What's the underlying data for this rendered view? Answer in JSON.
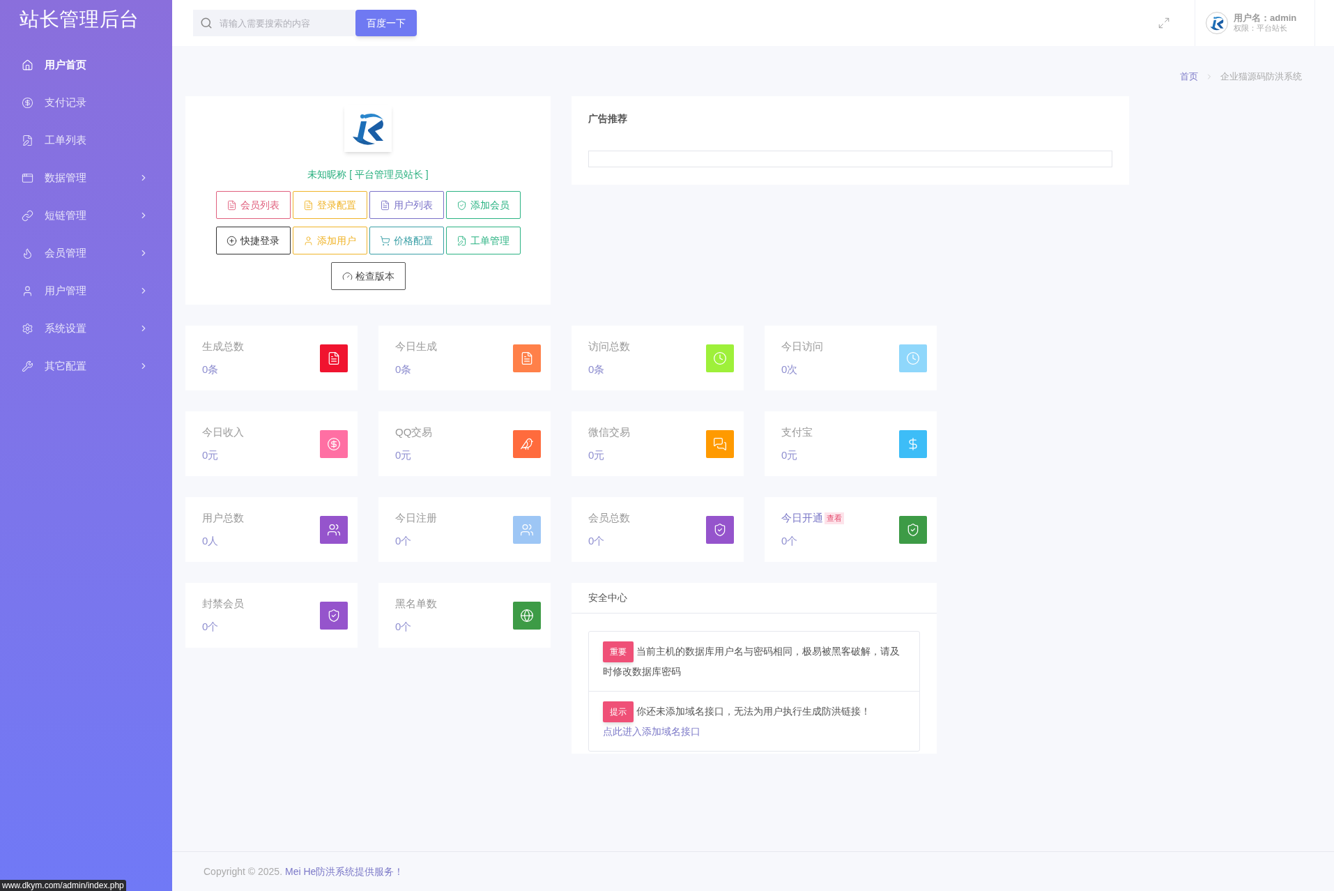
{
  "sidebar": {
    "title": "站长管理后台",
    "items": [
      {
        "label": "用户首页",
        "kind": "home",
        "selected": true,
        "expandable": false
      },
      {
        "label": "支付记录",
        "kind": "yen",
        "selected": false,
        "expandable": false
      },
      {
        "label": "工单列表",
        "kind": "ticket",
        "selected": false,
        "expandable": false
      },
      {
        "label": "数据管理",
        "kind": "window",
        "selected": false,
        "expandable": true
      },
      {
        "label": "短链管理",
        "kind": "link",
        "selected": false,
        "expandable": true
      },
      {
        "label": "会员管理",
        "kind": "flame",
        "selected": false,
        "expandable": true
      },
      {
        "label": "用户管理",
        "kind": "user",
        "selected": false,
        "expandable": true
      },
      {
        "label": "系统设置",
        "kind": "gear",
        "selected": false,
        "expandable": true
      },
      {
        "label": "其它配置",
        "kind": "tools",
        "selected": false,
        "expandable": true
      }
    ]
  },
  "header": {
    "search": {
      "placeholder": "请输入需要搜索的内容"
    },
    "search_button": "百度一下",
    "user_label": "用户名：admin",
    "role_label": "权限：平台站长"
  },
  "breadcrumb": {
    "home": "首页",
    "current": "企业猫源码防洪系统"
  },
  "profile": {
    "nickname": "未知昵称 [ 平台管理员站长 ]",
    "buttons": [
      {
        "label": "会员列表",
        "kind": "doc",
        "color": "#e0607e"
      },
      {
        "label": "登录配置",
        "kind": "doc",
        "color": "#f0b429"
      },
      {
        "label": "用户列表",
        "kind": "doc",
        "color": "#7a72c8"
      },
      {
        "label": "添加会员",
        "kind": "shield",
        "color": "#2bb383"
      },
      {
        "label": "快捷登录",
        "kind": "plus",
        "color": "#333333"
      },
      {
        "label": "添加用户",
        "kind": "user",
        "color": "#f0b429"
      },
      {
        "label": "价格配置",
        "kind": "cart",
        "color": "#3a9fa6"
      },
      {
        "label": "工单管理",
        "kind": "ticket",
        "color": "#2bb383"
      }
    ],
    "check_button": "检查版本"
  },
  "ad": {
    "title": "广告推荐"
  },
  "stats": [
    {
      "title": "生成总数",
      "value": "0条",
      "kind": "doc",
      "color": "#f0142f",
      "linked": false
    },
    {
      "title": "今日生成",
      "value": "0条",
      "kind": "doc",
      "color": "#ff8049",
      "linked": false
    },
    {
      "title": "访问总数",
      "value": "0条",
      "kind": "clock",
      "color": "#9ef03a",
      "linked": false
    },
    {
      "title": "今日访问",
      "value": "0次",
      "kind": "clock",
      "color": "#8fd7fb",
      "linked": false
    },
    {
      "title": "今日收入",
      "value": "0元",
      "kind": "yen",
      "color": "#ff6fa3",
      "linked": false
    },
    {
      "title": "QQ交易",
      "value": "0元",
      "kind": "bird",
      "color": "#ff6b3d",
      "linked": false
    },
    {
      "title": "微信交易",
      "value": "0元",
      "kind": "chat",
      "color": "#ff9a00",
      "linked": false
    },
    {
      "title": "支付宝",
      "value": "0元",
      "kind": "dollar",
      "color": "#3dbdf7",
      "linked": false
    },
    {
      "title": "用户总数",
      "value": "0人",
      "kind": "users",
      "color": "#9554cc",
      "linked": false
    },
    {
      "title": "今日注册",
      "value": "0个",
      "kind": "users",
      "color": "#9dc6f5",
      "linked": false
    },
    {
      "title": "会员总数",
      "value": "0个",
      "kind": "shield",
      "color": "#9554cc",
      "linked": false
    },
    {
      "title": "今日开通",
      "value": "0个",
      "kind": "shield",
      "color": "#3d9b46",
      "linked": true,
      "badge": "查看"
    },
    {
      "title": "封禁会员",
      "value": "0个",
      "kind": "shield",
      "color": "#9554cc",
      "linked": false
    },
    {
      "title": "黑名单数",
      "value": "0个",
      "kind": "globe",
      "color": "#3d9b46",
      "linked": false
    }
  ],
  "security": {
    "title": "安全中心",
    "notices": [
      {
        "tag": "重要",
        "text": "当前主机的数据库用户名与密码相同，极易被黑客破解，请及时修改数据库密码"
      },
      {
        "tag": "提示",
        "text": "你还未添加域名接口，无法为用户执行生成防洪链接！",
        "link": "点此进入添加域名接口"
      }
    ]
  },
  "footer": {
    "copyright": "Copyright © 2025.",
    "link": "Mei He防洪系统提供服务！"
  },
  "status_bar": {
    "url": "www.dkym.com/admin/index.php"
  }
}
